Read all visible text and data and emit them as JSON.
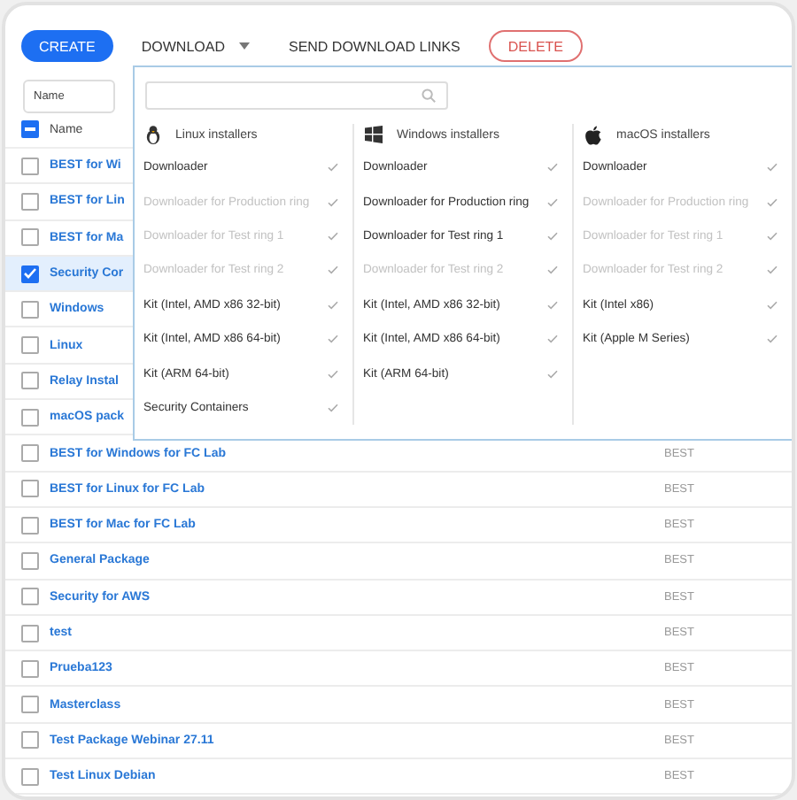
{
  "toolbar": [
    {
      "label": "CREATE",
      "kind": "primary"
    },
    {
      "label": "DOWNLOAD",
      "kind": "dropdown"
    },
    {
      "label": "SEND DOWNLOAD LINKS",
      "kind": "text"
    },
    {
      "label": "DELETE",
      "kind": "danger"
    }
  ],
  "filter": {
    "placeholder": "Name"
  },
  "table": {
    "header": {
      "label": "Name",
      "partial": true
    },
    "rows": [
      {
        "name": "BEST for Wi",
        "checked": false,
        "selected": false
      },
      {
        "name": "BEST for Lin",
        "checked": false,
        "selected": false
      },
      {
        "name": "BEST for Ma",
        "checked": false,
        "selected": false
      },
      {
        "name": "Security Cor",
        "checked": true,
        "selected": true
      },
      {
        "name": "Windows",
        "checked": false,
        "selected": false
      },
      {
        "name": "Linux",
        "checked": false,
        "selected": false
      },
      {
        "name": "Relay Instal",
        "checked": false,
        "selected": false
      },
      {
        "name": "macOS pack",
        "checked": false,
        "selected": false
      },
      {
        "name": "BEST for Windows for FC Lab",
        "type": "BEST",
        "checked": false,
        "selected": false
      },
      {
        "name": "BEST for Linux for FC Lab",
        "type": "BEST",
        "checked": false,
        "selected": false
      },
      {
        "name": "BEST for Mac for FC Lab",
        "type": "BEST",
        "checked": false,
        "selected": false
      },
      {
        "name": "General Package",
        "type": "BEST",
        "checked": false,
        "selected": false
      },
      {
        "name": "Security for AWS",
        "type": "BEST",
        "checked": false,
        "selected": false
      },
      {
        "name": "test",
        "type": "BEST",
        "checked": false,
        "selected": false
      },
      {
        "name": "Prueba123",
        "type": "BEST",
        "checked": false,
        "selected": false
      },
      {
        "name": "Masterclass",
        "type": "BEST",
        "checked": false,
        "selected": false
      },
      {
        "name": "Test Package Webinar 27.11",
        "type": "BEST",
        "checked": false,
        "selected": false
      },
      {
        "name": "Test Linux Debian",
        "type": "BEST",
        "checked": false,
        "selected": false
      }
    ]
  },
  "download_menu": {
    "columns": [
      {
        "kind": "linux",
        "title": "Linux installers",
        "items": [
          {
            "label": "Downloader",
            "disabled": false
          },
          {
            "label": "Downloader for Production ring",
            "disabled": true
          },
          {
            "label": "Downloader for Test ring 1",
            "disabled": true
          },
          {
            "label": "Downloader for Test ring 2",
            "disabled": true
          },
          {
            "label": "Kit (Intel, AMD x86 32-bit)",
            "disabled": false
          },
          {
            "label": "Kit (Intel, AMD x86 64-bit)",
            "disabled": false
          },
          {
            "label": "Kit (ARM 64-bit)",
            "disabled": false
          },
          {
            "label": "Security Containers",
            "disabled": false
          }
        ]
      },
      {
        "kind": "windows",
        "title": "Windows installers",
        "items": [
          {
            "label": "Downloader",
            "disabled": false
          },
          {
            "label": "Downloader for Production ring",
            "disabled": false
          },
          {
            "label": "Downloader for Test ring 1",
            "disabled": false
          },
          {
            "label": "Downloader for Test ring 2",
            "disabled": true
          },
          {
            "label": "Kit (Intel, AMD x86 32-bit)",
            "disabled": false
          },
          {
            "label": "Kit (Intel, AMD x86 64-bit)",
            "disabled": false
          },
          {
            "label": "Kit (ARM 64-bit)",
            "disabled": false
          }
        ]
      },
      {
        "kind": "macos",
        "title": "macOS installers",
        "items": [
          {
            "label": "Downloader",
            "disabled": false
          },
          {
            "label": "Downloader for Production ring",
            "disabled": true
          },
          {
            "label": "Downloader for Test ring 1",
            "disabled": true
          },
          {
            "label": "Downloader for Test ring 2",
            "disabled": true
          },
          {
            "label": "Kit (Intel x86)",
            "disabled": false
          },
          {
            "label": "Kit (Apple M Series)",
            "disabled": false
          }
        ]
      }
    ]
  }
}
